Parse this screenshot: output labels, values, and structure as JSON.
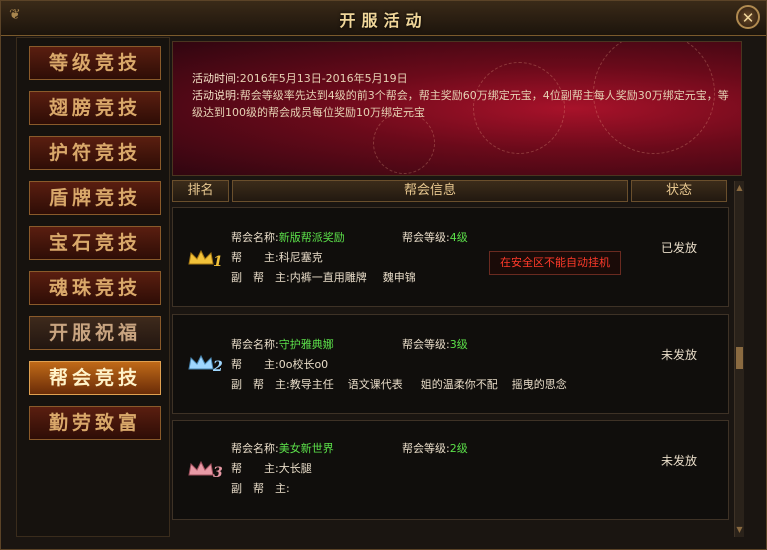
{
  "window": {
    "title": "开服活动",
    "close_glyph": "✕"
  },
  "sidebar": {
    "items": [
      {
        "label": "等级竞技",
        "state": "normal"
      },
      {
        "label": "翅膀竞技",
        "state": "normal"
      },
      {
        "label": "护符竞技",
        "state": "normal"
      },
      {
        "label": "盾牌竞技",
        "state": "normal"
      },
      {
        "label": "宝石竞技",
        "state": "normal"
      },
      {
        "label": "魂珠竞技",
        "state": "normal"
      },
      {
        "label": "开服祝福",
        "state": "plain"
      },
      {
        "label": "帮会竞技",
        "state": "active"
      },
      {
        "label": "勤劳致富",
        "state": "normal"
      }
    ]
  },
  "banner": {
    "time_label": "活动时间:",
    "time_value": "2016年5月13日-2016年5月19日",
    "desc_label": "活动说明:",
    "desc_value": "帮会等级率先达到4级的前3个帮会，帮主奖励60万绑定元宝，4位副帮主每人奖励30万绑定元宝，等级达到100级的帮会成员每位奖励10万绑定元宝"
  },
  "table": {
    "headers": [
      "排名",
      "帮会信息",
      "状态"
    ],
    "name_label": "帮会名称:",
    "level_label": "帮会等级:",
    "leader_label": "帮　　主:",
    "vice_label": "副　帮　主:",
    "rows": [
      {
        "rank": "1",
        "rank_icon": "gold-crown-icon",
        "name": "新版帮派奖励",
        "level": "4级",
        "leader": "科尼塞克",
        "vices": [
          "内裤一直用雕牌",
          "魏申锦"
        ],
        "status": "已发放",
        "warning": "在安全区不能自动挂机"
      },
      {
        "rank": "2",
        "rank_icon": "silver-crown-icon",
        "name": "守护雅典娜",
        "level": "3级",
        "leader": "0o校长o0",
        "vices": [
          "教导主任",
          "语文课代表",
          "姐的温柔你不配",
          "摇曳的思念"
        ],
        "status": "未发放",
        "warning": ""
      },
      {
        "rank": "3",
        "rank_icon": "bronze-crown-icon",
        "name": "美女新世界",
        "level": "2级",
        "leader": "大长腿",
        "vices": [],
        "status": "未发放",
        "warning": ""
      }
    ]
  },
  "colors": {
    "accent_green": "#5ce14a",
    "warning_red": "#ff3a2a",
    "active_tab": "#c06a18",
    "gold": "#f2c23a",
    "silver": "#9fd7ff",
    "bronze": "#e89aa6"
  }
}
